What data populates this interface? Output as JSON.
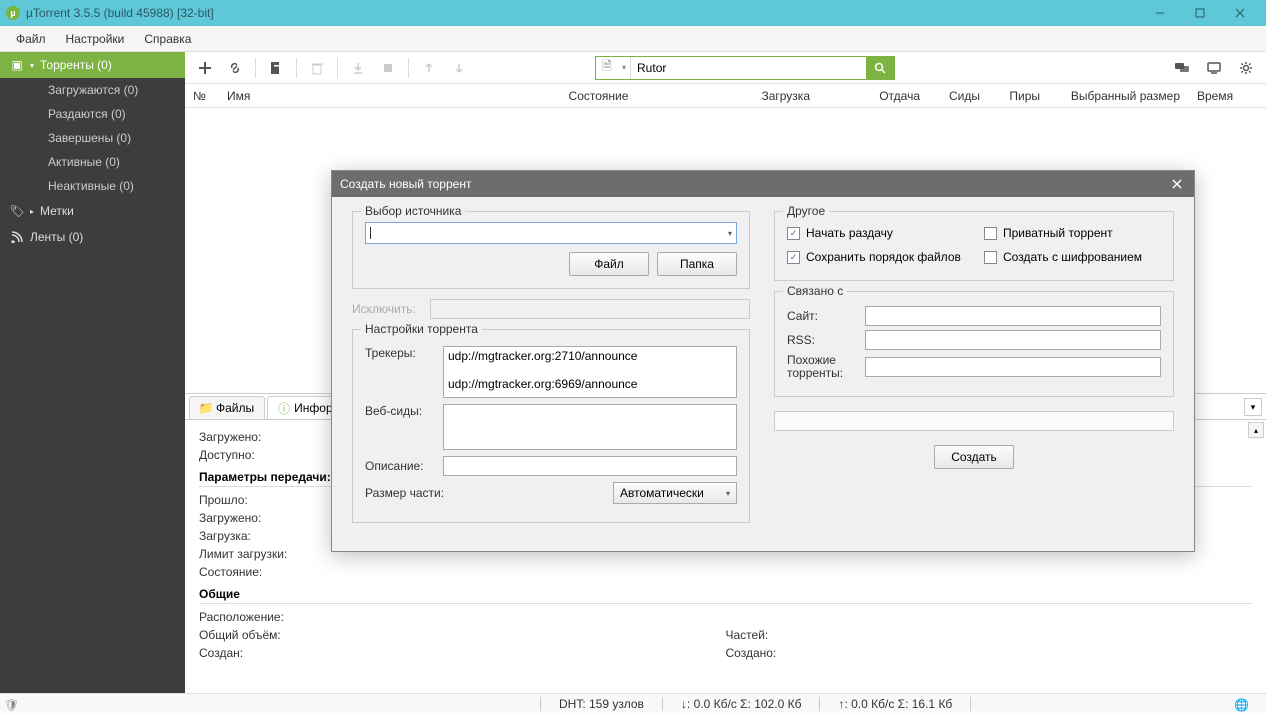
{
  "titlebar": {
    "title": "µTorrent 3.5.5  (build 45988) [32-bit]"
  },
  "menu": [
    "Файл",
    "Настройки",
    "Справка"
  ],
  "sidebar": {
    "torrents": {
      "label": "Торренты (0)",
      "subs": [
        "Загружаются (0)",
        "Раздаются (0)",
        "Завершены (0)",
        "Активные (0)",
        "Неактивные (0)"
      ]
    },
    "labels": "Метки",
    "feeds": "Ленты (0)"
  },
  "search": {
    "provider": "Rutor"
  },
  "columns": [
    "№",
    "Имя",
    "Состояние",
    "Загрузка",
    "Отдача",
    "Сиды",
    "Пиры",
    "Выбранный размер",
    "Время"
  ],
  "detail": {
    "tabs": {
      "files": "Файлы",
      "info": "Информа"
    },
    "downloaded": "Загружено:",
    "available": "Доступно:",
    "transfer_hdr": "Параметры передачи:",
    "elapsed": "Прошло:",
    "downloaded2": "Загружено:",
    "download": "Загрузка:",
    "dl_limit": "Лимит загрузки:",
    "state": "Состояние:",
    "general_hdr": "Общие",
    "location": "Расположение:",
    "total_size": "Общий объём:",
    "created": "Создан:",
    "pieces": "Частей:",
    "created_on": "Создано:"
  },
  "status": {
    "dht": "DHT: 159 узлов",
    "down": "↓: 0.0 Кб/с Σ: 102.0 Кб",
    "up": "↑: 0.0 Кб/с Σ: 16.1 Кб"
  },
  "dialog": {
    "title": "Создать новый торрент",
    "source_legend": "Выбор источника",
    "file_btn": "Файл",
    "folder_btn": "Папка",
    "exclude": "Исключить:",
    "settings_legend": "Настройки торрента",
    "trackers_label": "Трекеры:",
    "trackers": "udp://mgtracker.org:2710/announce\n\nudp://mgtracker.org:6969/announce",
    "webseeds": "Веб-сиды:",
    "description": "Описание:",
    "piece_size": "Размер части:",
    "piece_auto": "Автоматически",
    "other_legend": "Другое",
    "chk_start": "Начать раздачу",
    "chk_private": "Приватный торрент",
    "chk_preserve": "Сохранить порядок файлов",
    "chk_encrypt": "Создать с шифрованием",
    "related_legend": "Связано с",
    "site": "Сайт:",
    "rss": "RSS:",
    "similar": "Похожие торренты:",
    "create": "Создать"
  }
}
